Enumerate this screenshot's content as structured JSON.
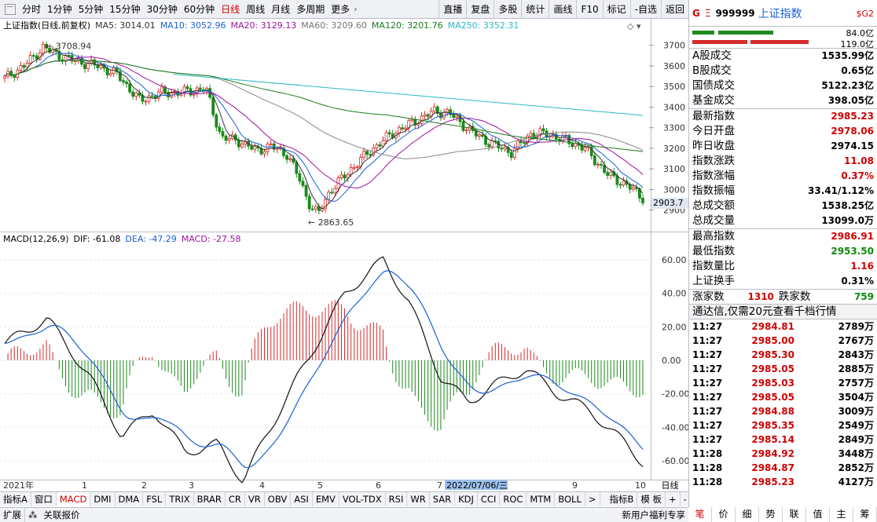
{
  "toolbar": {
    "left": [
      "分时",
      "1分钟",
      "5分钟",
      "15分钟",
      "30分钟",
      "60分钟",
      "日线",
      "周线",
      "月线",
      "多周期",
      "更多"
    ],
    "active": "日线",
    "right": [
      "直播",
      "复盘",
      "多股",
      "统计",
      "画线",
      "F10",
      "标记",
      "-自选",
      "返回"
    ]
  },
  "kline_info": {
    "title": "上证指数(日线,前复权)",
    "ma5": "MA5: 3014.01",
    "ma10": "MA10: 3052.96",
    "ma20": "MA20: 3129.13",
    "ma60": "MA60: 3209.60",
    "ma120": "MA120: 3201.76",
    "ma250": "MA250: 3352.31"
  },
  "colors": {
    "ma5": "#333333",
    "ma10": "#1a5fd6",
    "ma20": "#a010a0",
    "ma60": "#888888",
    "ma120": "#1a7a1a",
    "ma250": "#2ab8c8",
    "up": "#d62a2a",
    "down": "#1a8a1a"
  },
  "price_axis": [
    "3700",
    "3600",
    "3500",
    "3400",
    "3300",
    "3200",
    "3100",
    "3000",
    "2900"
  ],
  "current_price_label": "2903.7",
  "annotations": {
    "high": "3708.94",
    "low": "2863.65"
  },
  "macd_info": {
    "title": "MACD(12,26,9)",
    "dif": "DIF: -61.08",
    "dea": "DEA: -47.29",
    "macd": "MACD: -27.58"
  },
  "macd_axis": [
    "60.00",
    "40.00",
    "20.00",
    "0.00",
    "-20.00",
    "-40.00",
    "-60.00"
  ],
  "date_axis": {
    "labels": [
      "2021年",
      "1",
      "2",
      "3",
      "4",
      "5",
      "6",
      "7",
      "9",
      "10"
    ],
    "cursor": "2022/07/06/三",
    "period": "日线"
  },
  "indicator_tabs": [
    "指标A",
    "窗口",
    "MACD",
    "DMI",
    "DMA",
    "FSL",
    "TRIX",
    "BRAR",
    "CR",
    "VR",
    "OBV",
    "ASI",
    "EMV",
    "VOL-TDX",
    "RSI",
    "WR",
    "SAR",
    "KDJ",
    "CCI",
    "ROC",
    "MTM",
    "BOLL",
    ">",
    "指标B",
    "模 板",
    "+",
    "-"
  ],
  "indicator_active": "MACD",
  "status": {
    "left1": "扩展",
    "left2": "关联报价",
    "right1": "新用户福利专享"
  },
  "side": {
    "g": "G",
    "eq": "Ξ",
    "code": "999999",
    "name": "上证指数",
    "sg": "$G2",
    "bar_v1": "84.0亿",
    "bar_v2": "119.0亿",
    "rows1": [
      {
        "l": "A股成交",
        "v": "1535.99亿",
        "c": ""
      },
      {
        "l": "B股成交",
        "v": "0.65亿",
        "c": ""
      },
      {
        "l": "国债成交",
        "v": "5122.23亿",
        "c": ""
      },
      {
        "l": "基金成交",
        "v": "398.05亿",
        "c": ""
      }
    ],
    "rows2": [
      {
        "l": "最新指数",
        "v": "2985.23",
        "c": "red"
      },
      {
        "l": "今日开盘",
        "v": "2978.06",
        "c": "red"
      },
      {
        "l": "昨日收盘",
        "v": "2974.15",
        "c": ""
      },
      {
        "l": "指数涨跌",
        "v": "11.08",
        "c": "red"
      },
      {
        "l": "指数涨幅",
        "v": "0.37%",
        "c": "red"
      },
      {
        "l": "指数振幅",
        "v": "33.41/1.12%",
        "c": ""
      },
      {
        "l": "总成交额",
        "v": "1538.25亿",
        "c": ""
      },
      {
        "l": "总成交量",
        "v": "13099.0万",
        "c": ""
      }
    ],
    "rows3": [
      {
        "l": "最高指数",
        "v": "2986.91",
        "c": "red"
      },
      {
        "l": "最低指数",
        "v": "2953.50",
        "c": "green"
      },
      {
        "l": "指数量比",
        "v": "1.16",
        "c": "red"
      },
      {
        "l": "上证换手",
        "v": "0.31%",
        "c": ""
      }
    ],
    "zhangjia_label": "涨家数",
    "zhangjia": "1310",
    "diejia_label": "跌家数",
    "diejia": "759",
    "ad": "通达信,仅需20元查看千档行情",
    "ticks": [
      {
        "t": "11:27",
        "p": "2984.81",
        "q": "2789万"
      },
      {
        "t": "11:27",
        "p": "2985.00",
        "q": "2767万"
      },
      {
        "t": "11:27",
        "p": "2985.30",
        "q": "2843万"
      },
      {
        "t": "11:27",
        "p": "2985.05",
        "q": "2885万"
      },
      {
        "t": "11:27",
        "p": "2985.03",
        "q": "2757万"
      },
      {
        "t": "11:27",
        "p": "2985.05",
        "q": "3504万"
      },
      {
        "t": "11:27",
        "p": "2984.88",
        "q": "3009万"
      },
      {
        "t": "11:27",
        "p": "2985.35",
        "q": "2549万"
      },
      {
        "t": "11:27",
        "p": "2985.14",
        "q": "2849万"
      },
      {
        "t": "11:28",
        "p": "2984.92",
        "q": "3448万"
      },
      {
        "t": "11:28",
        "p": "2984.87",
        "q": "2852万"
      },
      {
        "t": "11:28",
        "p": "2985.23",
        "q": "4127万"
      }
    ],
    "tabs": [
      "笔",
      "价",
      "细",
      "势",
      "联",
      "值",
      "主",
      "筹"
    ]
  }
}
